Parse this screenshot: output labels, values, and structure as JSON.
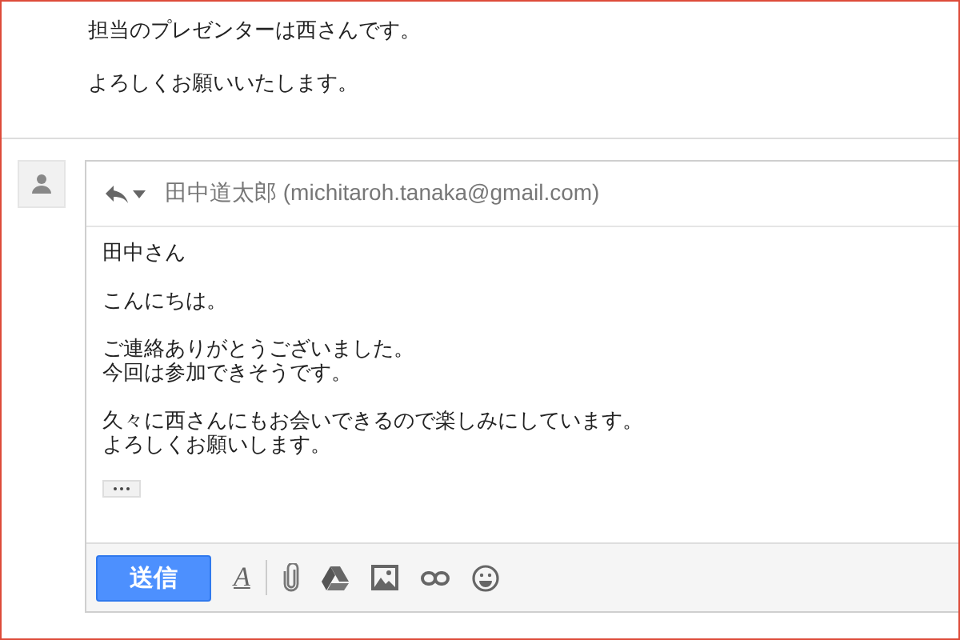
{
  "previous_message": {
    "lines": [
      "担当のプレゼンターは西さんです。",
      "よろしくお願いいたします。"
    ]
  },
  "reply": {
    "recipient_name": "田中道太郎",
    "recipient_email": "(michitaroh.tanaka@gmail.com)",
    "paragraphs": [
      [
        "田中さん"
      ],
      [
        "こんにちは。"
      ],
      [
        "ご連絡ありがとうございました。",
        "今回は参加できそうです。"
      ],
      [
        "久々に西さんにもお会いできるので楽しみにしています。",
        "よろしくお願いします。"
      ]
    ],
    "send_button": "送信",
    "format_icon": "A"
  }
}
